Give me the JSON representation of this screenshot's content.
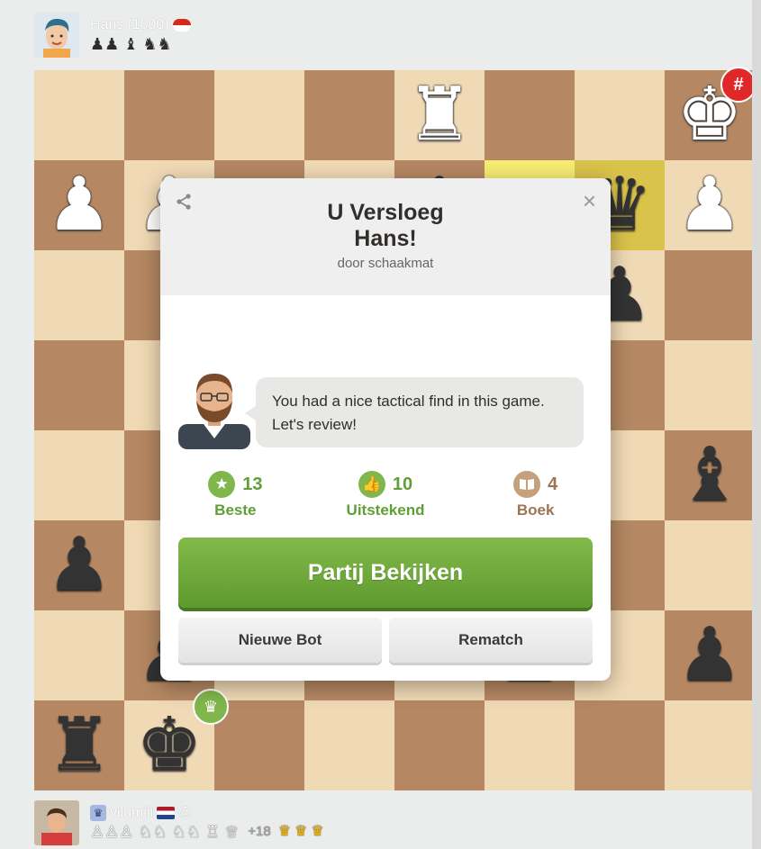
{
  "top_player": {
    "name": "Hans",
    "rating": "(1000)",
    "captured": "♟♟ ♝ ♞♞"
  },
  "bottom_player": {
    "name": "vilumiii",
    "captured": "♙♙♙ ♘♘ ♘♘ ♖ ♕",
    "advantage": "+18",
    "crowns": "♛♛♛"
  },
  "board": {
    "rows": [
      [
        "",
        "",
        "",
        "",
        "♜w",
        "",
        "",
        "♚w"
      ],
      [
        "♟w",
        "♟w",
        "",
        "",
        "♟b",
        "",
        "♛b",
        "♟w"
      ],
      [
        "",
        "",
        "",
        "",
        "",
        "",
        "♟b",
        ""
      ],
      [
        "",
        "",
        "",
        "",
        "",
        "",
        "",
        ""
      ],
      [
        "",
        "",
        "",
        "",
        "",
        "",
        "",
        "♝b"
      ],
      [
        "♟b",
        "",
        "",
        "",
        "",
        "",
        "",
        ""
      ],
      [
        "",
        "♟b",
        "",
        "",
        "",
        "♟b",
        "",
        "♟b"
      ],
      [
        "♜b",
        "♚b",
        "",
        "",
        "",
        "",
        "",
        ""
      ]
    ],
    "highlights": [
      [
        1,
        5
      ],
      [
        1,
        6
      ]
    ]
  },
  "modal": {
    "title_line1": "U Versloeg",
    "title_line2": "Hans!",
    "subtitle": "door schaakmat",
    "coach_message": "You had a nice tactical find in this game. Let's review!",
    "stats": [
      {
        "value": "13",
        "label": "Beste",
        "icon": "star-icon",
        "color": "#81b64c"
      },
      {
        "value": "10",
        "label": "Uitstekend",
        "icon": "thumbs-up-icon",
        "color": "#81b64c"
      },
      {
        "value": "4",
        "label": "Boek",
        "icon": "book-icon",
        "color": "#c4a07c"
      }
    ],
    "review_button": "Partij Bekijken",
    "new_bot_button": "Nieuwe Bot",
    "rematch_button": "Rematch"
  },
  "colors": {
    "light_square": "#f0d9b5",
    "dark_square": "#b58863",
    "accent_green": "#81b64c",
    "mate_red": "#e02828"
  }
}
